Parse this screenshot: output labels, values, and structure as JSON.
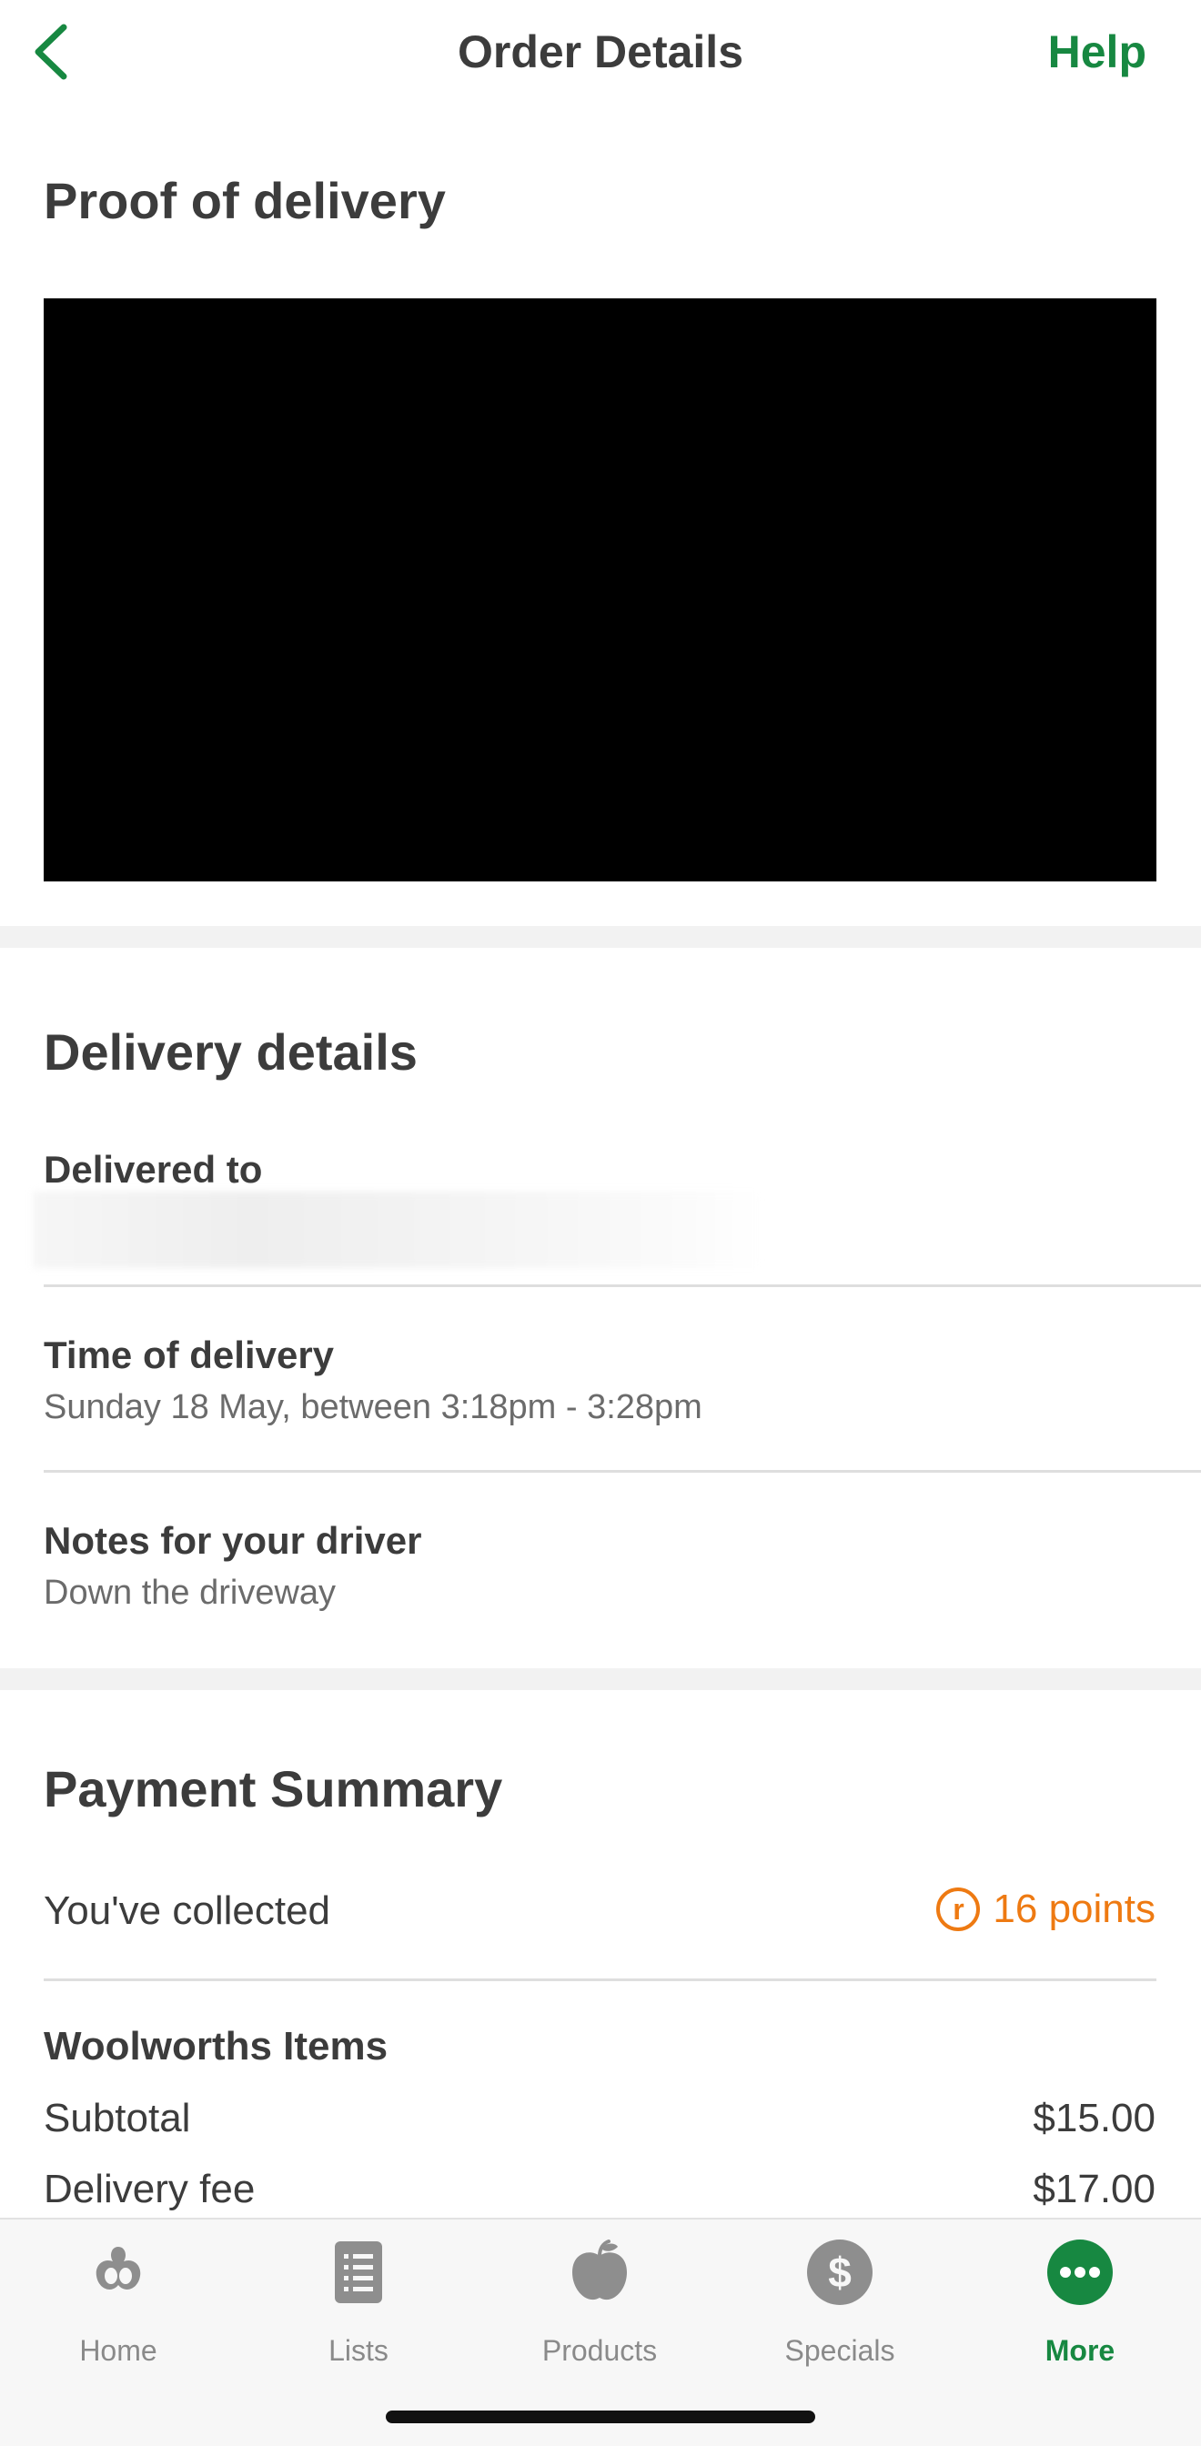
{
  "header": {
    "title": "Order Details",
    "help_label": "Help",
    "accent_color": "#178841"
  },
  "proof_of_delivery": {
    "title": "Proof of delivery"
  },
  "delivery_details": {
    "title": "Delivery details",
    "delivered_to_label": "Delivered to",
    "time_label": "Time of delivery",
    "time_value": "Sunday 18 May, between 3:18pm - 3:28pm",
    "notes_label": "Notes for your driver",
    "notes_value": "Down the driveway"
  },
  "payment_summary": {
    "title": "Payment Summary",
    "collected_label": "You've collected",
    "points_label": "16 points",
    "points_icon": "rewards-icon",
    "points_color": "#ee7a12",
    "section_title": "Woolworths Items",
    "rows": [
      {
        "label": "Subtotal",
        "value": "$15.00"
      },
      {
        "label": "Delivery fee",
        "value": "$17.00"
      }
    ]
  },
  "tabbar": {
    "tabs": [
      {
        "label": "Home",
        "icon": "woolworths-logo-icon",
        "active": false
      },
      {
        "label": "Lists",
        "icon": "list-icon",
        "active": false
      },
      {
        "label": "Products",
        "icon": "apple-icon",
        "active": false
      },
      {
        "label": "Specials",
        "icon": "dollar-icon",
        "active": false
      },
      {
        "label": "More",
        "icon": "more-dots-icon",
        "active": true
      }
    ]
  }
}
